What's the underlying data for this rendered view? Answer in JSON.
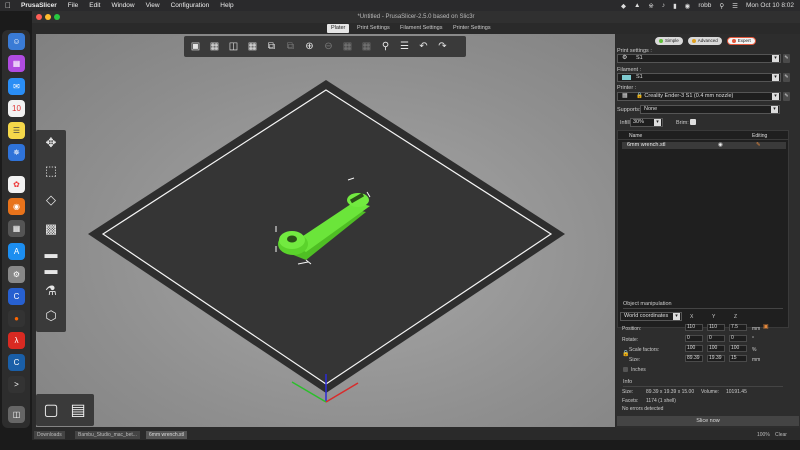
{
  "menubar": {
    "apple": "",
    "app": "PrusaSlicer",
    "items": [
      "File",
      "Edit",
      "Window",
      "View",
      "Configuration",
      "Help"
    ],
    "user": "robb",
    "datetime": "Mon Oct 10  8:02"
  },
  "window": {
    "title": "*Untitled - PrusaSlicer-2.5.0 based on Slic3r",
    "tabs": [
      "Plater",
      "Print Settings",
      "Filament Settings",
      "Printer Settings"
    ],
    "active_tab": "Plater"
  },
  "modes": [
    "Simple",
    "Advanced",
    "Expert"
  ],
  "panel": {
    "print_settings_label": "Print settings :",
    "print_settings_value": "S1",
    "filament_label": "Filament :",
    "filament_value": "S1",
    "filament_color": "#7ecad0",
    "printer_label": "Printer :",
    "printer_value": "Creality Ender-3 S1 (0.4 mm nozzle)",
    "supports_label": "Supports:",
    "supports_value": "None",
    "infill_label": "Infill:",
    "infill_value": "30%",
    "brim_label": "Brim:",
    "col_name": "Name",
    "col_editing": "Editing",
    "object_name": "6mm wrench.stl"
  },
  "object_manipulation": {
    "title": "Object manipulation",
    "coords": "World coordinates",
    "axes": [
      "X",
      "Y",
      "Z"
    ],
    "position_label": "Position:",
    "position": [
      "110",
      "110",
      "7.5"
    ],
    "position_unit": "mm",
    "rotate_label": "Rotate:",
    "rotate": [
      "0",
      "0",
      "0"
    ],
    "rotate_unit": "°",
    "scale_label": "Scale factors:",
    "scale": [
      "100",
      "100",
      "100"
    ],
    "scale_unit": "%",
    "size_label": "Size:",
    "size": [
      "89.39",
      "19.39",
      "15"
    ],
    "size_unit": "mm",
    "inches_label": "Inches"
  },
  "info": {
    "title": "Info",
    "size_label": "Size:",
    "size_value": "89.39 x 19.39 x 15.00",
    "volume_label": "Volume:",
    "volume_value": "10191.45",
    "facets_label": "Facets:",
    "facets_value": "1174 (1 shell)",
    "errors": "No errors detected"
  },
  "slice_button": "Slice now",
  "statusbar": {
    "items": [
      "Downloads",
      "Bambu_Studio_mac_bet...",
      "6mm wrench.stl"
    ],
    "zoom": "100%",
    "clear": "Clear"
  },
  "colors": {
    "model": "#6be53a",
    "bed": "#2e2e2e",
    "expert": "#e2573b",
    "simple": "#5fbf3a",
    "advanced": "#e0a020"
  }
}
